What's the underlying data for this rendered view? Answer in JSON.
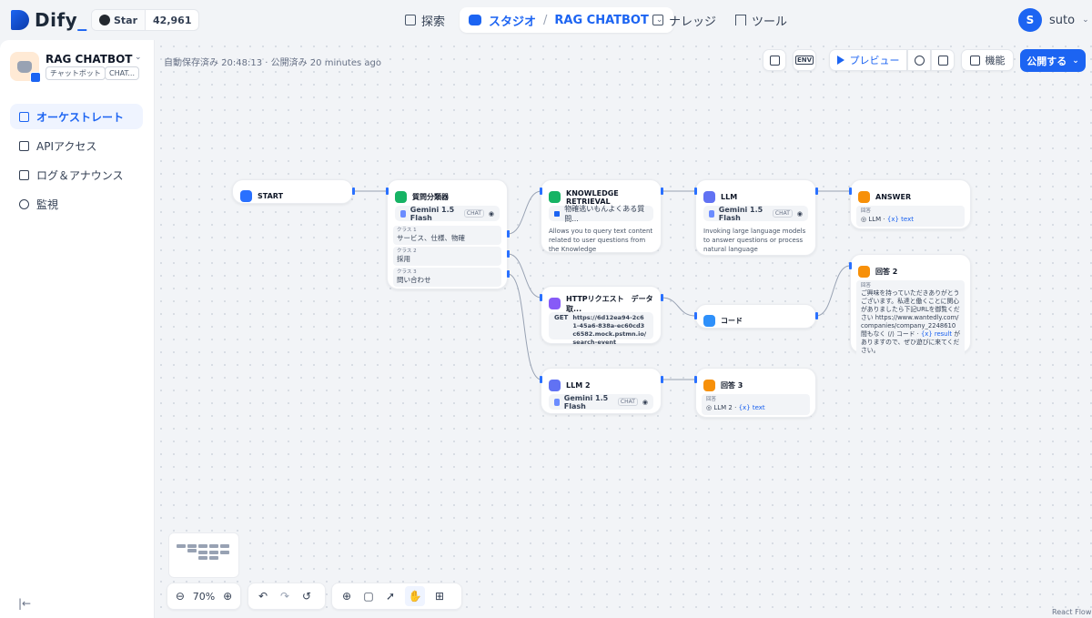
{
  "header": {
    "logo": "Dify",
    "github_star": "Star",
    "github_count": "42,961",
    "nav_explore": "探索",
    "nav_studio": "スタジオ",
    "nav_app": "RAG CHATBOT",
    "nav_knowledge": "ナレッジ",
    "nav_tools": "ツール",
    "user_initial": "S",
    "user_name": "suto"
  },
  "sidebar": {
    "app_name": "RAG CHATBOT",
    "tag_type": "チャットボット",
    "tag_mode": "CHAT...",
    "items": [
      {
        "label": "オーケストレート",
        "active": true
      },
      {
        "label": "APIアクセス"
      },
      {
        "label": "ログ＆アナウンス"
      },
      {
        "label": "監視"
      }
    ]
  },
  "toolbar": {
    "autosave": "自動保存済み 20:48:13 · 公開済み 20 minutes ago",
    "env": "ENV",
    "preview": "プレビュー",
    "features": "機能",
    "publish": "公開する"
  },
  "nodes": {
    "start": {
      "title": "START"
    },
    "classifier": {
      "title": "質問分類器",
      "model": "Gemini 1.5 Flash",
      "mode": "CHAT",
      "classes": [
        {
          "label": "クラス 1",
          "value": "サービス、仕様、物確"
        },
        {
          "label": "クラス 2",
          "value": "採用"
        },
        {
          "label": "クラス 3",
          "value": "問い合わせ"
        }
      ]
    },
    "knowledge": {
      "title": "KNOWLEDGE RETRIEVAL",
      "dataset": "物確逃いもんよくある質問...",
      "desc": "Allows you to query text content related to user questions from the Knowledge"
    },
    "llm": {
      "title": "LLM",
      "model": "Gemini 1.5 Flash",
      "mode": "CHAT",
      "desc": "Invoking large language models to answer questions or process natural language"
    },
    "answer": {
      "title": "ANSWER",
      "label": "回答",
      "src": "LLM",
      "var": "{x} text"
    },
    "http": {
      "title": "HTTPリクエスト　データ取...",
      "method": "GET",
      "url": "https://6d12ea94-2c61-45a6-838a-ec60cd3c6582.mock.pstmn.io/search-event"
    },
    "code": {
      "title": "コード"
    },
    "answer2": {
      "title": "回答 2",
      "label": "回答",
      "text1": "ご興味を持っていただきありがとうございます。私達と働くことに関心がありましたら下記URLを御覧ください https://www.wantedly.com/companies/company_2248610 間もなく",
      "src": "コード",
      "var": "{x} result",
      "text2": "がありますので、ぜひ遊びに来てください。"
    },
    "llm2": {
      "title": "LLM 2",
      "model": "Gemini 1.5 Flash",
      "mode": "CHAT"
    },
    "answer3": {
      "title": "回答 3",
      "label": "回答",
      "src": "LLM 2",
      "var": "{x} text"
    }
  },
  "controls": {
    "zoom": "70%"
  },
  "attribution": "React Flow",
  "colors": {
    "accent": "#1c64f2"
  }
}
